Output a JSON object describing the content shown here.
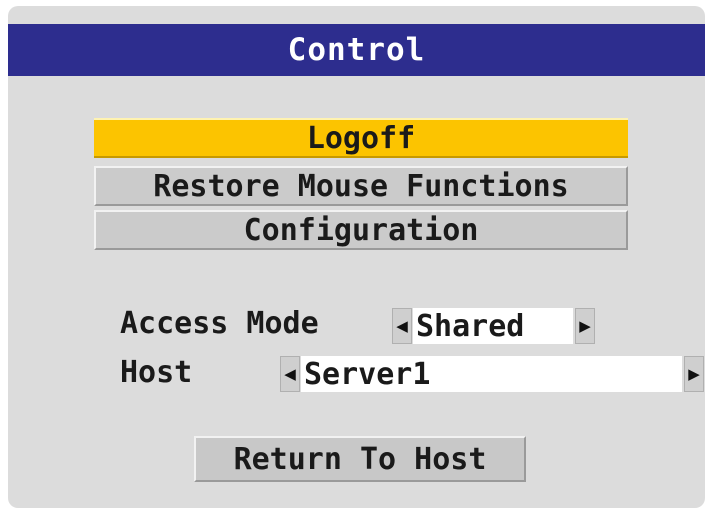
{
  "title": "Control",
  "menu": {
    "items": [
      {
        "label": "Logoff"
      },
      {
        "label": "Restore Mouse Functions"
      },
      {
        "label": "Configuration"
      }
    ]
  },
  "access_mode": {
    "label": "Access Mode",
    "value": "Shared"
  },
  "host": {
    "label": "Host",
    "value": "Server1"
  },
  "return_button": {
    "label": "Return To Host"
  },
  "colors": {
    "title_bar": "#2d2d8e",
    "selected_item": "#fcc400",
    "panel": "#dcdcdc"
  },
  "icons": {
    "left_arrow": "arrow-left-icon",
    "right_arrow": "arrow-right-icon"
  }
}
